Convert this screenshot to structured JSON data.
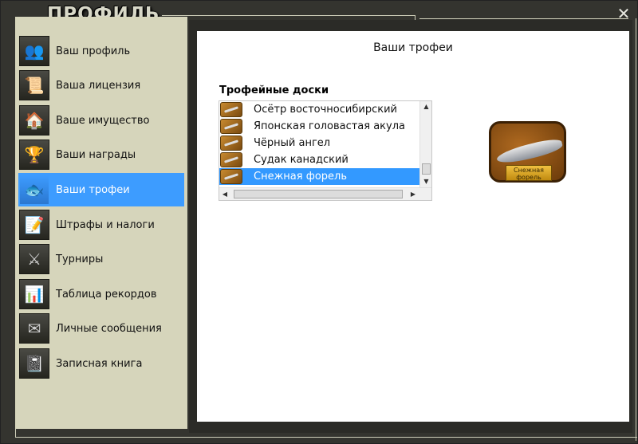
{
  "window": {
    "title": "ПРОФИЛЬ",
    "close_label": "✕"
  },
  "sidebar": {
    "items": [
      {
        "label": "Ваш профиль",
        "icon": "users-icon",
        "glyph": "👥"
      },
      {
        "label": "Ваша лицензия",
        "icon": "license-icon",
        "glyph": "📜"
      },
      {
        "label": "Ваше имущество",
        "icon": "house-icon",
        "glyph": "🏠"
      },
      {
        "label": "Ваши награды",
        "icon": "trophy-cup-icon",
        "glyph": "🏆"
      },
      {
        "label": "Ваши трофеи",
        "icon": "fish-trophy-icon",
        "glyph": "🐟"
      },
      {
        "label": "Штрафы и налоги",
        "icon": "document-edit-icon",
        "glyph": "📝"
      },
      {
        "label": "Турниры",
        "icon": "crossed-swords-icon",
        "glyph": "⚔"
      },
      {
        "label": "Таблица рекордов",
        "icon": "bar-chart-icon",
        "glyph": "📊"
      },
      {
        "label": "Личные сообщения",
        "icon": "envelope-icon",
        "glyph": "✉"
      },
      {
        "label": "Записная книга",
        "icon": "notebook-icon",
        "glyph": "📓"
      }
    ],
    "active_index": 4
  },
  "main": {
    "title": "Ваши трофеи",
    "section_label": "Трофейные доски",
    "list": [
      {
        "label": "Осётр восточносибирский"
      },
      {
        "label": "Японская головастая акула"
      },
      {
        "label": "Чёрный ангел"
      },
      {
        "label": "Судак канадский"
      },
      {
        "label": "Снежная форель"
      }
    ],
    "selected_index": 4,
    "preview": {
      "plate_text": "Снежная форель"
    }
  },
  "colors": {
    "accent": "#3d9cff",
    "sidebar_bg": "#d6d5bb",
    "frame_bg": "#34342f"
  }
}
